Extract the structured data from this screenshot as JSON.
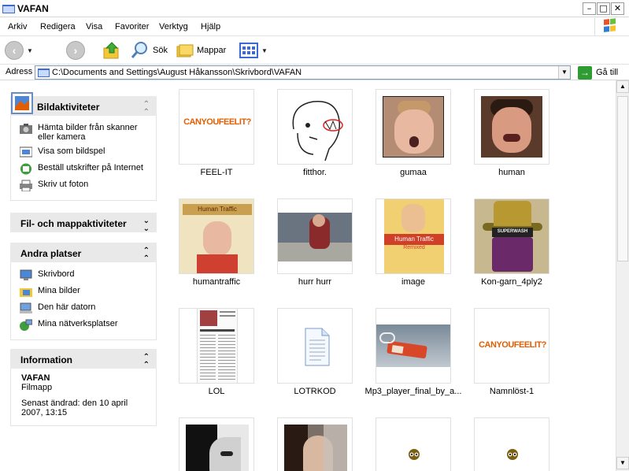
{
  "window": {
    "title": "VAFAN"
  },
  "menu": [
    "Arkiv",
    "Redigera",
    "Visa",
    "Favoriter",
    "Verktyg",
    "Hjälp"
  ],
  "toolbar": {
    "search_label": "Sök",
    "folders_label": "Mappar"
  },
  "address": {
    "label": "Adress",
    "path": "C:\\Documents and Settings\\August Håkansson\\Skrivbord\\VAFAN",
    "go_label": "Gå till"
  },
  "panels": {
    "image_tasks": {
      "title": "Bildaktiviteter",
      "items": [
        "Hämta bilder från skanner eller kamera",
        "Visa som bildspel",
        "Beställ utskrifter på Internet",
        "Skriv ut foton"
      ]
    },
    "file_tasks": {
      "title": "Fil- och mappaktiviteter"
    },
    "other_places": {
      "title": "Andra platser",
      "items": [
        "Skrivbord",
        "Mina bilder",
        "Den här datorn",
        "Mina nätverksplatser"
      ]
    },
    "details": {
      "title": "Information",
      "name": "VAFAN",
      "type": "Filmapp",
      "modified": "Senast ändrad: den 10 april 2007, 13:15"
    }
  },
  "files": [
    {
      "name": "FEEL-IT",
      "thumb_text": "CANYOUFEELIT?"
    },
    {
      "name": "fitthor."
    },
    {
      "name": "gumaa"
    },
    {
      "name": "human"
    },
    {
      "name": "humantraffic",
      "thumb_text": "Human Traffic"
    },
    {
      "name": "hurr hurr"
    },
    {
      "name": "image",
      "thumb_text": "Human Traffic",
      "thumb_subtext": "Remixed"
    },
    {
      "name": "Kon-garn_4ply2",
      "thumb_text": "SUPERWASH"
    },
    {
      "name": "LOL"
    },
    {
      "name": "LOTRKOD"
    },
    {
      "name": "Mp3_player_final_by_a..."
    },
    {
      "name": "Namnlöst-1",
      "thumb_text": "CANYOUFEELIT?"
    },
    {
      "name": ""
    },
    {
      "name": ""
    },
    {
      "name": ""
    },
    {
      "name": ""
    }
  ],
  "colors": {
    "accent": "#e35e00",
    "panel_header": "#e9e9e9",
    "folder": "#f3c73a"
  }
}
